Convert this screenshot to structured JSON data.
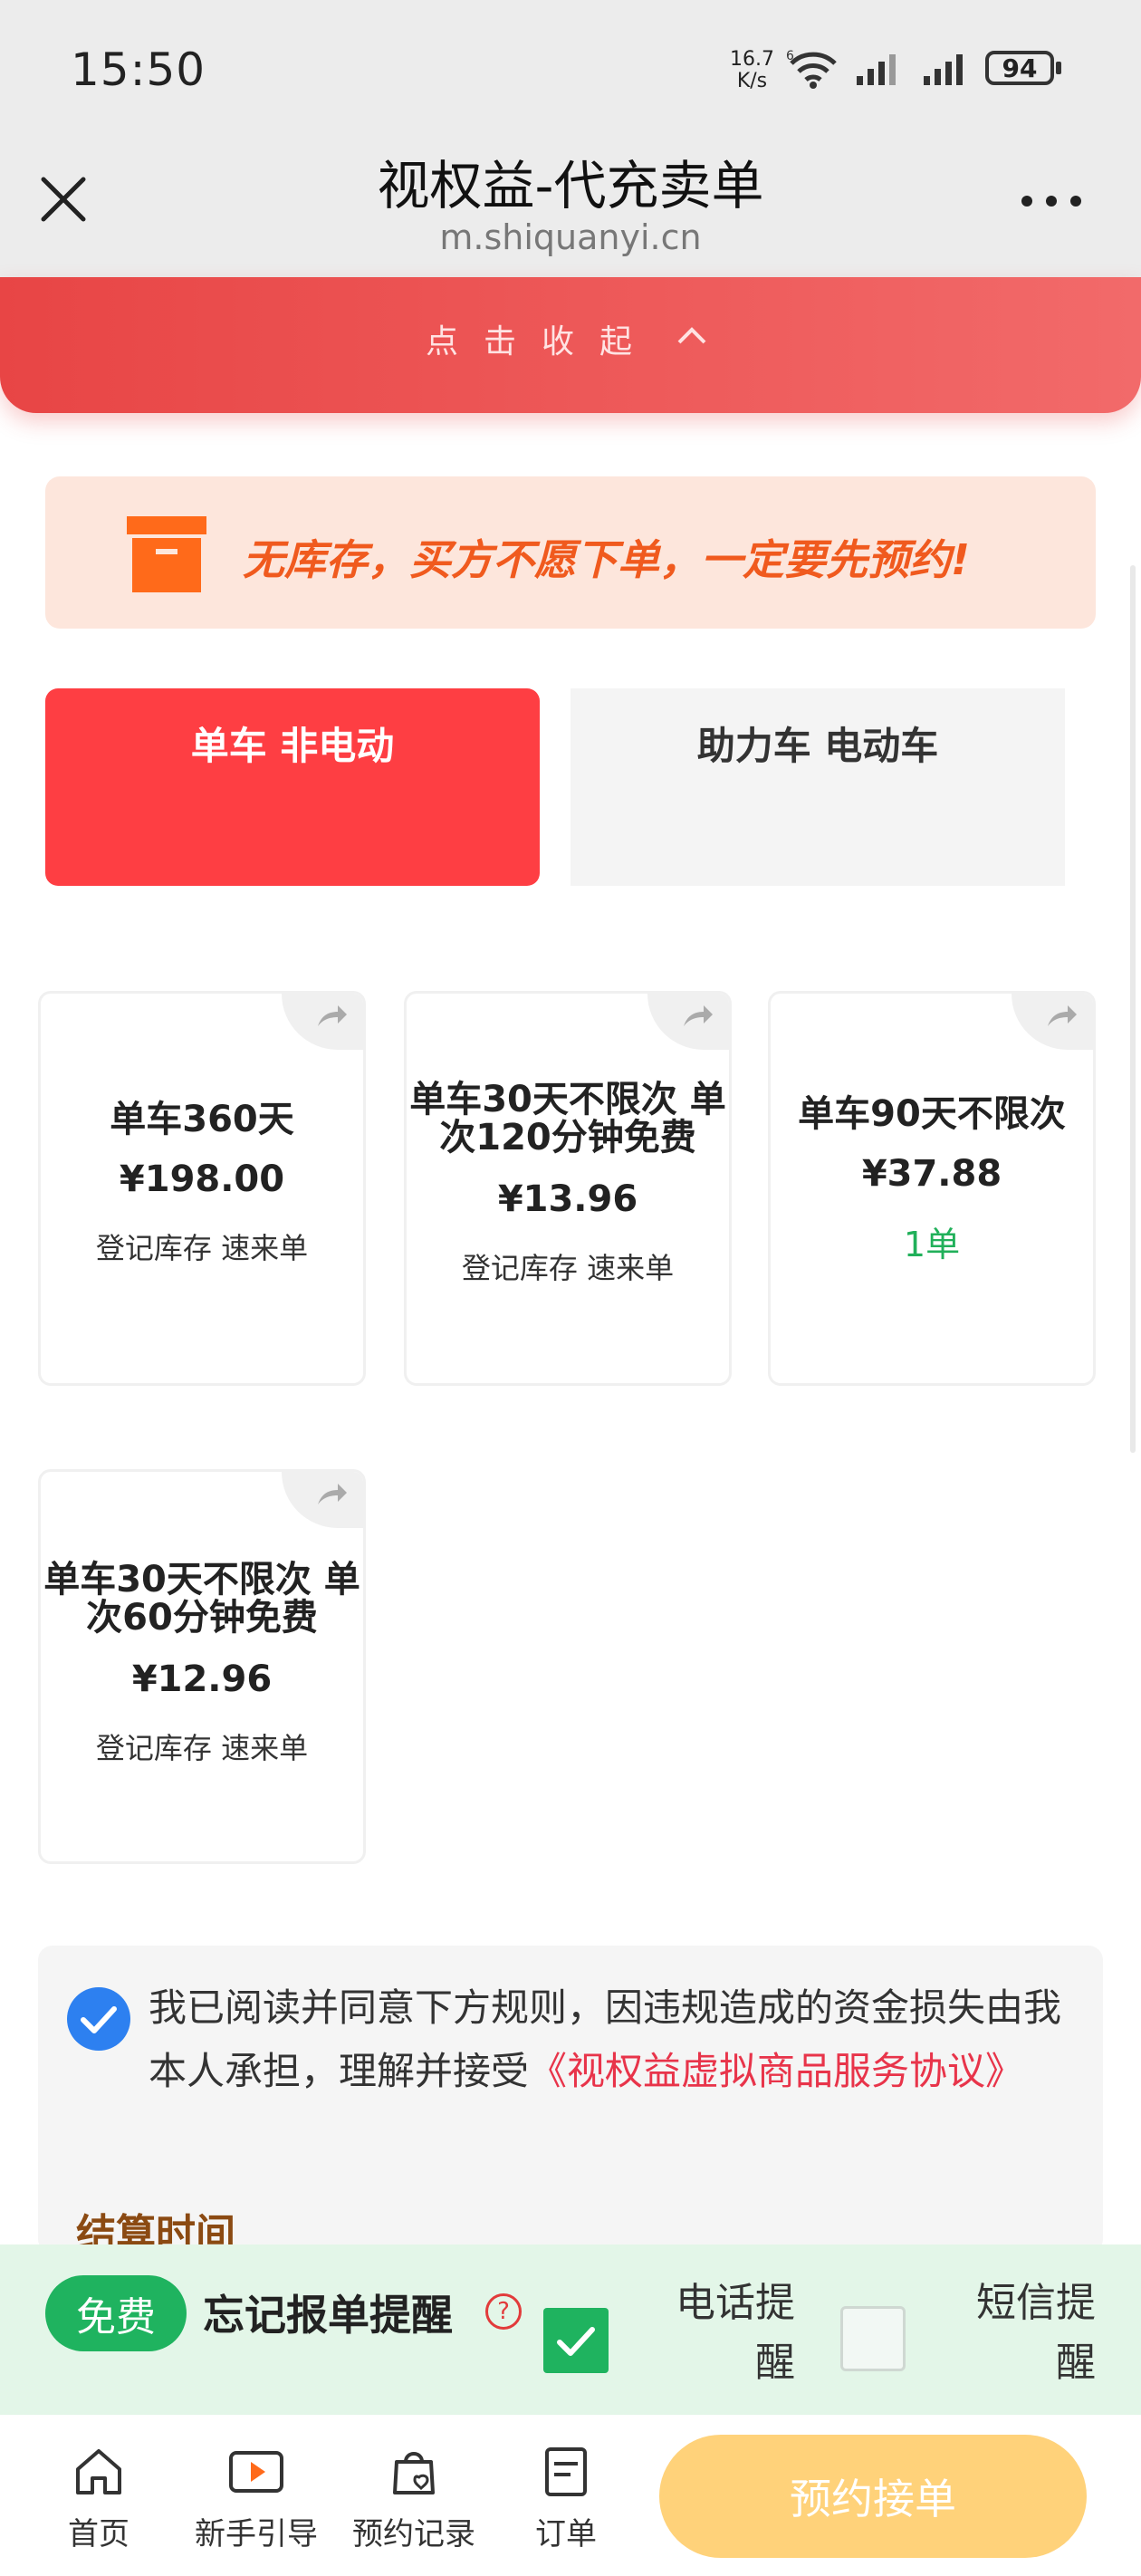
{
  "status_bar": {
    "time": "15:50",
    "net_speed_value": "16.7",
    "net_speed_unit": "K/s",
    "wifi_label": "6",
    "battery": "94"
  },
  "title_bar": {
    "title": "视权益-代充卖单",
    "url": "m.shiquanyi.cn"
  },
  "collapse": {
    "label": "点击收起"
  },
  "notice": {
    "text": "无库存，买方不愿下单，一定要先预约!"
  },
  "tabs": [
    {
      "label": "单车 非电动",
      "active": true
    },
    {
      "label": "助力车 电动车",
      "active": false
    }
  ],
  "products": [
    {
      "name_line1": "单车360天",
      "name_line2": "",
      "price": "¥198.00",
      "status": "登记库存 速来单"
    },
    {
      "name_line1": "单车30天不限次 单",
      "name_line2": "次120分钟免费",
      "price": "¥13.96",
      "status": "登记库存 速来单"
    },
    {
      "name_line1": "单车90天不限次",
      "name_line2": "",
      "price": "¥37.88",
      "status": "1单"
    },
    {
      "name_line1": "单车30天不限次 单",
      "name_line2": "次60分钟免费",
      "price": "¥12.96",
      "status": "登记库存 速来单"
    }
  ],
  "agreement": {
    "text": "我已阅读并同意下方规则，因违规造成的资金损失由我本人承担，理解并接受",
    "link": "《视权益虚拟商品服务协议》",
    "checked": true,
    "section_title": "结算时间"
  },
  "reminder": {
    "free_badge": "免费",
    "label": "忘记报单提醒",
    "help": "?",
    "phone_label": "电话提醒",
    "phone_checked": true,
    "sms_label": "短信提醒",
    "sms_checked": false
  },
  "bottom_nav": {
    "items": [
      {
        "label": "首页",
        "icon": "home-icon"
      },
      {
        "label": "新手引导",
        "icon": "play-video-icon"
      },
      {
        "label": "预约记录",
        "icon": "bag-heart-icon"
      },
      {
        "label": "订单",
        "icon": "order-list-icon"
      }
    ],
    "reserve_button": "预约接单"
  },
  "colors": {
    "accent_red": "#fe3e43",
    "notice_orange": "#f05a1e",
    "green": "#1fb35f",
    "link_red": "#e8344a",
    "button_yellow": "#ffd27a"
  }
}
